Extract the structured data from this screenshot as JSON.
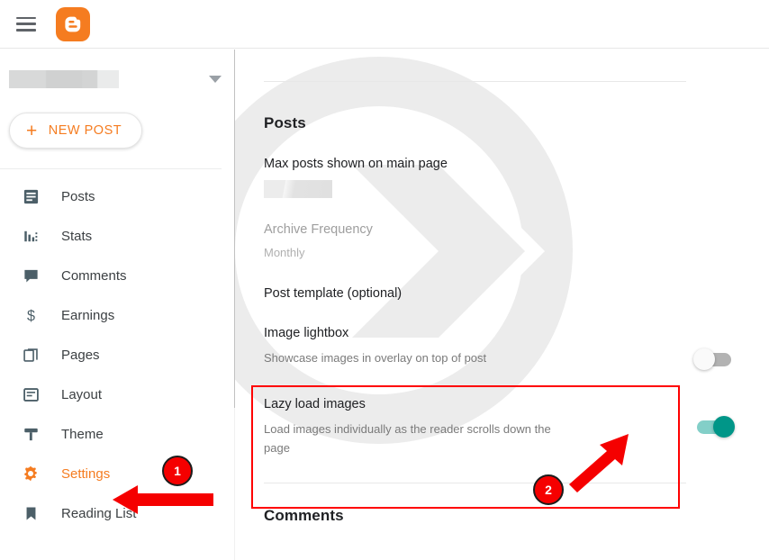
{
  "topbar": {
    "menu_icon": "hamburger-menu-icon",
    "logo_icon": "blogger-logo-icon",
    "logo_color": "#f57c20"
  },
  "sidebar": {
    "blog_selector": {
      "name_redacted": "",
      "caret_icon": "chevron-down-icon"
    },
    "new_post": {
      "plus": "+",
      "label": "NEW POST"
    },
    "items": [
      {
        "label": "Posts",
        "icon": "posts-icon",
        "active": false
      },
      {
        "label": "Stats",
        "icon": "stats-icon",
        "active": false
      },
      {
        "label": "Comments",
        "icon": "comments-icon",
        "active": false
      },
      {
        "label": "Earnings",
        "icon": "earnings-icon",
        "active": false
      },
      {
        "label": "Pages",
        "icon": "pages-icon",
        "active": false
      },
      {
        "label": "Layout",
        "icon": "layout-icon",
        "active": false
      },
      {
        "label": "Theme",
        "icon": "theme-icon",
        "active": false
      },
      {
        "label": "Settings",
        "icon": "settings-gear-icon",
        "active": true
      },
      {
        "label": "Reading List",
        "icon": "reading-list-icon",
        "active": false
      }
    ],
    "active_color": "#f57c20"
  },
  "main": {
    "section_posts": "Posts",
    "rows": {
      "max_posts": {
        "title": "Max posts shown on main page",
        "value_redacted": ""
      },
      "archive_frequency": {
        "title": "Archive Frequency",
        "value": "Monthly"
      },
      "post_template": {
        "title": "Post template (optional)"
      },
      "image_lightbox": {
        "title": "Image lightbox",
        "subtitle": "Showcase images in overlay on top of post",
        "toggle_state": "off"
      },
      "lazy_load_images": {
        "title": "Lazy load images",
        "subtitle": "Load images individually as the reader scrolls down the page",
        "toggle_state": "on"
      }
    },
    "section_comments": "Comments"
  },
  "annotations": {
    "badge_1": "1",
    "badge_2": "2",
    "marker_color": "#f50000",
    "highlight_border_color": "#ff0000"
  }
}
